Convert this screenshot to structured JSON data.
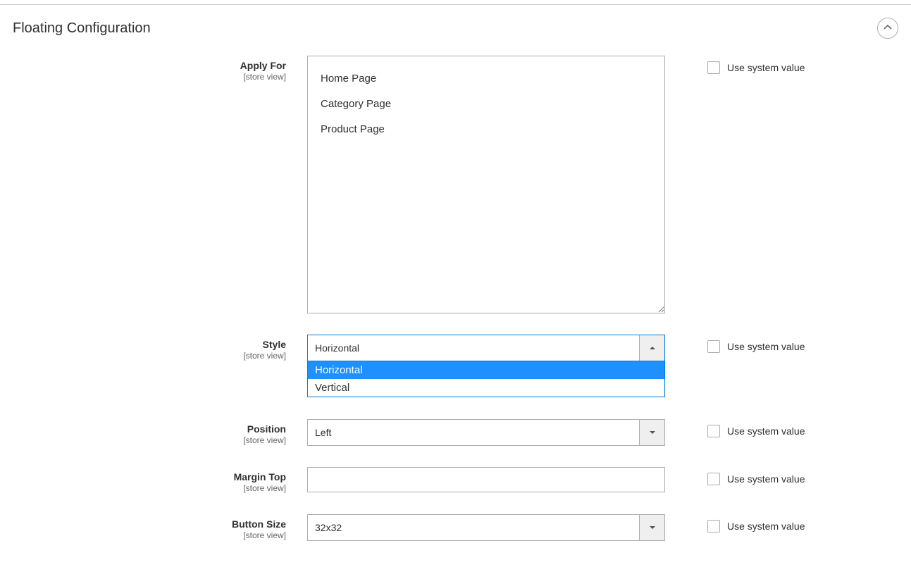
{
  "section": {
    "title": "Floating Configuration"
  },
  "common": {
    "scope_label": "[store view]",
    "use_system_value": "Use system value"
  },
  "fields": {
    "apply_for": {
      "label": "Apply For",
      "options": [
        "Home Page",
        "Category Page",
        "Product Page"
      ]
    },
    "style": {
      "label": "Style",
      "selected": "Horizontal",
      "options": [
        "Horizontal",
        "Vertical"
      ]
    },
    "position": {
      "label": "Position",
      "selected": "Left"
    },
    "margin_top": {
      "label": "Margin Top",
      "value": ""
    },
    "button_size": {
      "label": "Button Size",
      "selected": "32x32"
    }
  }
}
